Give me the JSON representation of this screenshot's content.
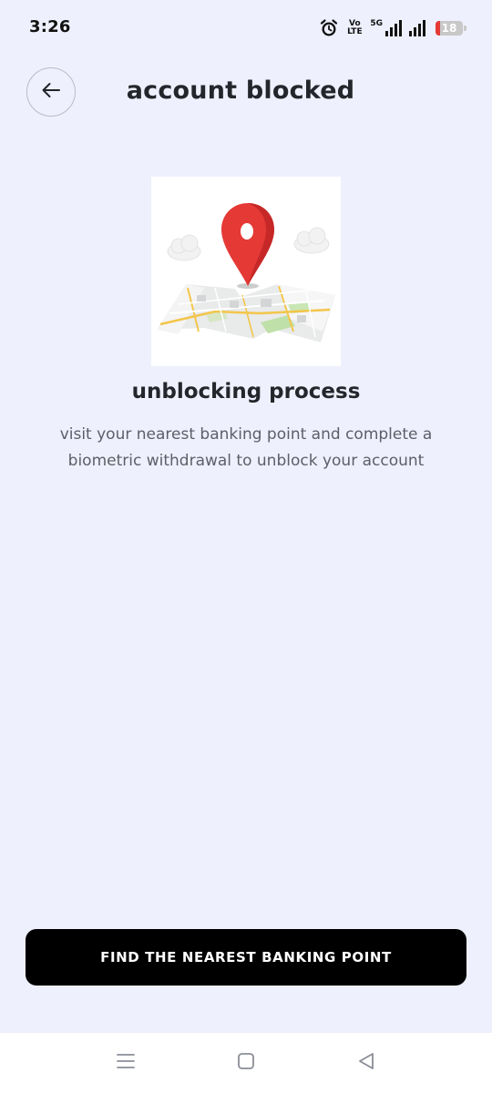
{
  "status_bar": {
    "time": "3:26",
    "network_label": "5G",
    "volte_top": "Vo",
    "volte_bottom": "LTE",
    "battery_level": "18"
  },
  "header": {
    "title": "account blocked"
  },
  "main": {
    "section_title": "unblocking process",
    "description": "visit your nearest banking point and complete a biometric withdrawal to unblock your account"
  },
  "actions": {
    "primary_label": "FIND THE NEAREST BANKING POINT"
  },
  "colors": {
    "background": "#eef0fd",
    "button": "#000000",
    "pin": "#e53935",
    "battery_low": "#e53935"
  },
  "icons": {
    "back": "arrow-left-icon",
    "alarm": "alarm-clock-icon",
    "signal": "signal-bars-icon",
    "battery": "battery-icon",
    "nav_menu": "menu-icon",
    "nav_home": "square-home-icon",
    "nav_back": "triangle-back-icon"
  }
}
